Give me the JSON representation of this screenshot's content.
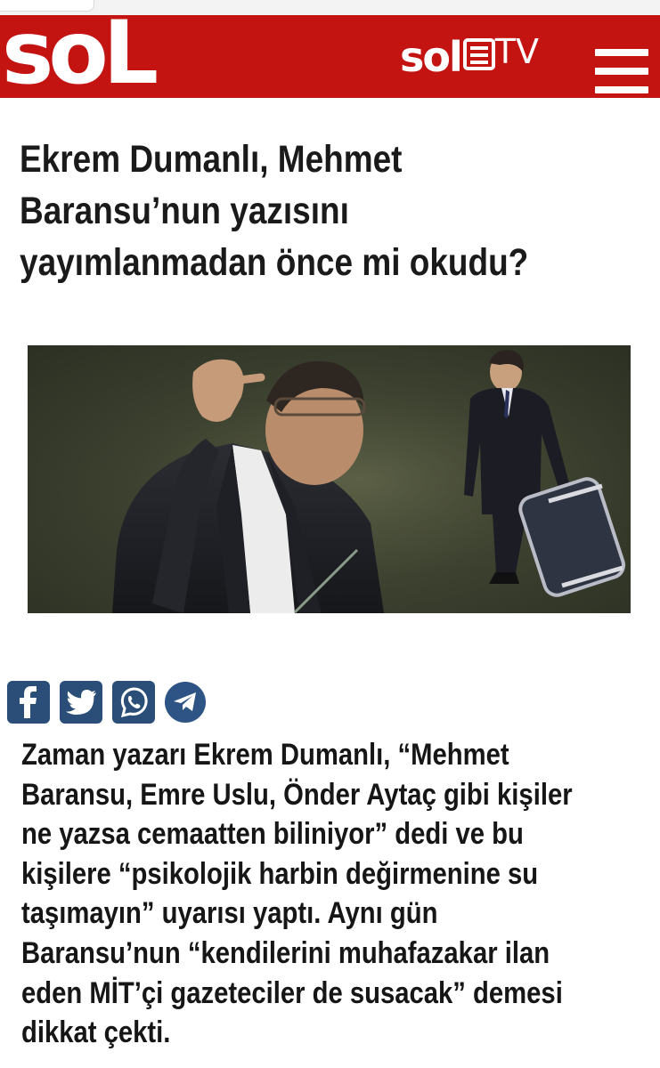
{
  "header": {
    "logo": "soL",
    "tv_brand": "sol",
    "tv_suffix": "TV",
    "menu_icon": "hamburger-menu-icon",
    "background_color": "#c41412"
  },
  "article": {
    "title_lines": [
      "Ekrem Dumanlı, Mehmet",
      "Baransu’nun yazısını",
      "yayımlanmadan önce mi okudu?"
    ],
    "body_lines": [
      "Zaman yazarı Ekrem Dumanlı, “Mehmet",
      "Baransu, Emre Uslu, Önder Aytaç gibi kişiler",
      "ne yazsa cemaatten biliniyor” dedi ve bu",
      "kişilere “psikolojik harbin değirmenine su",
      "taşımayın” uyarısı yaptı. Aynı gün",
      "Baransu’nun “kendilerini muhafazakar ilan",
      "eden MİT’çi gazeteciler de susacak” demesi",
      "dikkat çekti."
    ]
  },
  "share": {
    "icons": [
      "facebook-icon",
      "twitter-icon",
      "whatsapp-icon",
      "telegram-icon"
    ],
    "color": "#2a4e78"
  }
}
